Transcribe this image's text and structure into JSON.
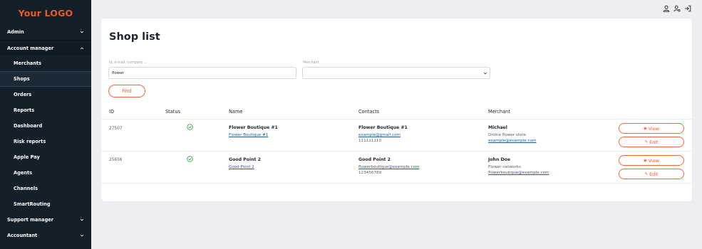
{
  "logo": "Your LOGO",
  "sidebar": {
    "items": [
      {
        "label": "Admin"
      },
      {
        "label": "Account manager"
      },
      {
        "label": "Merchants"
      },
      {
        "label": "Shops"
      },
      {
        "label": "Orders"
      },
      {
        "label": "Reports"
      },
      {
        "label": "Dashboard"
      },
      {
        "label": "Risk reports"
      },
      {
        "label": "Apple Pay"
      },
      {
        "label": "Agents"
      },
      {
        "label": "Channels"
      },
      {
        "label": "SmartRouting"
      },
      {
        "label": "Support manager"
      },
      {
        "label": "Accountant"
      }
    ]
  },
  "header_icons": [
    "user-icon",
    "user-settings-icon",
    "logout-icon"
  ],
  "page": {
    "title": "Shop list",
    "filters": {
      "search_label": "id, e-mail, company ...",
      "search_value": "flower",
      "merchant_label": "Merchant",
      "merchant_value": ""
    },
    "find_label": "Find"
  },
  "table": {
    "columns": [
      "ID",
      "Status",
      "Name",
      "Contacts",
      "Merchant"
    ],
    "rows": [
      {
        "id": "27507",
        "status": "active",
        "name": "Flower Boutique #1",
        "name_link": "Flower Boutique #1",
        "contact_name": "Flower Boutique #1",
        "contact_email": "example@gmail.com",
        "contact_phone": "111111110",
        "merchant_name": "Michael",
        "merchant_desc": "Online flower store",
        "merchant_email": "example@example.com",
        "view_label": "View",
        "edit_label": "Edit"
      },
      {
        "id": "25656",
        "status": "active",
        "name": "Good Point 2",
        "name_link": "Good Point 2",
        "contact_name": "Good Point 2",
        "contact_email": "flowerboutique@example.com",
        "contact_phone": "123456789",
        "merchant_name": "John Doe",
        "merchant_desc": "Flower networks",
        "merchant_email": "flowerboutique@example.com",
        "view_label": "View",
        "edit_label": "Edit"
      }
    ]
  },
  "colors": {
    "sidebar_bg": "#142029",
    "accent": "#ee5a24",
    "status_ok": "#3aa54a",
    "link": "#1d5fa6"
  }
}
